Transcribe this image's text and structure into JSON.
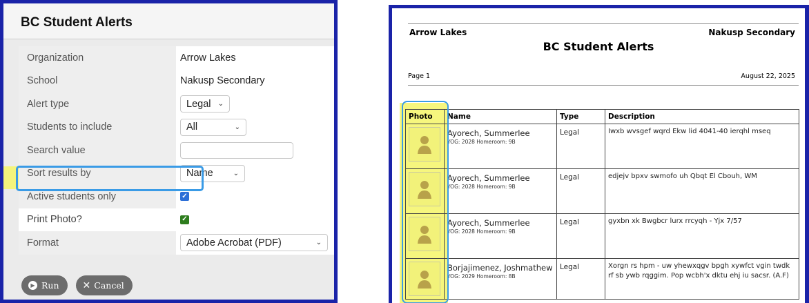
{
  "settings_panel": {
    "title": "BC Student Alerts",
    "rows": [
      {
        "label": "Organization",
        "value": "Arrow Lakes"
      },
      {
        "label": "School",
        "value": "Nakusp Secondary"
      },
      {
        "label": "Alert type",
        "value": "Legal"
      },
      {
        "label": "Students to include",
        "value": "All"
      },
      {
        "label": "Search value",
        "value": ""
      },
      {
        "label": "Sort results by",
        "value": "Name"
      },
      {
        "label": "Active students only",
        "checked": true
      },
      {
        "label": "Print Photo?",
        "checked": true
      },
      {
        "label": "Format",
        "value": "Adobe Acrobat (PDF)"
      }
    ],
    "buttons": {
      "run": "Run",
      "cancel": "Cancel"
    },
    "colors": {
      "highlight": "#f4f47c",
      "callout": "#3a9be6"
    }
  },
  "report": {
    "organization": "Arrow Lakes",
    "school": "Nakusp Secondary",
    "title": "BC Student Alerts",
    "page": "Page 1",
    "date": "August 22, 2025",
    "columns": [
      "Photo",
      "Name",
      "Type",
      "Description"
    ],
    "rows": [
      {
        "name": "Ayorech, Summerlee",
        "sub": "YOG: 2028 Homeroom: 9B",
        "type": "Legal",
        "description": "Iwxb wvsgef wqrd Ekw lid 4041-40 ierqhl mseq"
      },
      {
        "name": "Ayorech, Summerlee",
        "sub": "YOG: 2028 Homeroom: 9B",
        "type": "Legal",
        "description": "edjejv bpxv swmofo uh Qbqt El Cbouh, WM"
      },
      {
        "name": "Ayorech, Summerlee",
        "sub": "YOG: 2028 Homeroom: 9B",
        "type": "Legal",
        "description": "gyxbn xk Bwgbcr lurx rrcyqh - Yjx 7/57"
      },
      {
        "name": "Borjajimenez, Joshmathew",
        "sub": "YOG: 2029 Homeroom: 8B",
        "type": "Legal",
        "description": "Xorgn rs hpm - uw yhewxqgv bpgh xywfct vgin twdk rf sb ywb rqggim. Pop wcbh'x dktu ehj iu sacsr. (A.F)"
      }
    ]
  }
}
